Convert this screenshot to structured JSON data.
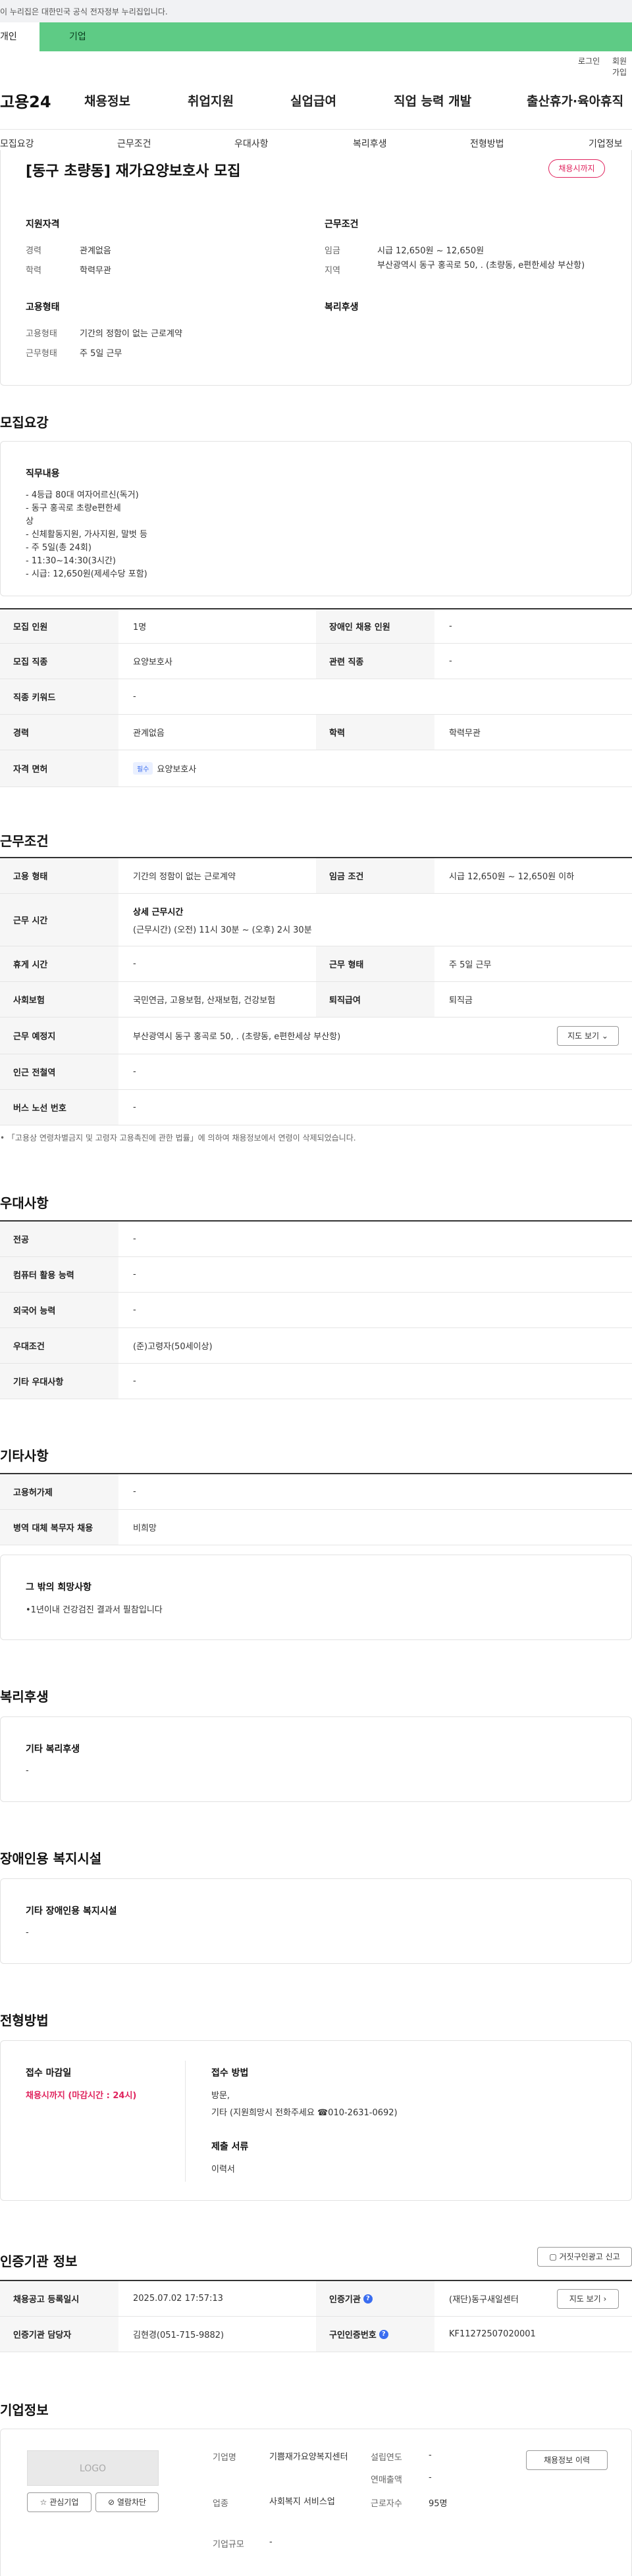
{
  "gov_banner": "이 누리집은 대한민국 공식 전자정부 누리집입니다.",
  "top_tabs": {
    "personal": "개인",
    "company": "기업"
  },
  "util": {
    "login": "로그인",
    "join": "회원가입"
  },
  "logo": "고용24",
  "gnb": [
    "채용정보",
    "취업지원",
    "실업급여",
    "직업 능력 개발",
    "출산휴가·육아휴직"
  ],
  "sub_nav": [
    "모집요강",
    "근무조건",
    "우대사항",
    "복리후생",
    "전형방법",
    "기업정보"
  ],
  "summary": {
    "title": "[동구 초량동] 재가요양보호사 모집",
    "badge": "채용시까지",
    "qual_title": "지원자격",
    "career_label": "경력",
    "career_value": "관계없음",
    "edu_label": "학력",
    "edu_value": "학력무관",
    "cond_title": "근무조건",
    "wage_label": "임금",
    "wage_value": "시급 12,650원 ~ 12,650원",
    "area_label": "지역",
    "area_value": "부산광역시 동구 홍곡로 50, . (초량동, e편한세상 부산항)",
    "emp_title": "고용형태",
    "emp_type_label": "고용형태",
    "emp_type_value": "기간의 정함이 없는 근로계약",
    "work_form_label": "근무형태",
    "work_form_value": "주 5일 근무",
    "welfare_title": "복리후생"
  },
  "recruit": {
    "section_title": "모집요강",
    "duty_title": "직무내용",
    "duty_lines": [
      "- 4등급 80대 여자어르신(독거)",
      "- 동구 홍곡로 초량e편한세",
      "상",
      "- 신체활동지원, 가사지원, 말벗 등",
      "- 주 5일(총 24회)",
      "- 11:30~14:30(3시간)",
      "- 시급: 12,650원(제세수당 포함)"
    ],
    "rows": [
      {
        "l1": "모집 인원",
        "v1": "1명",
        "l2": "장애인 채용 인원",
        "v2": "-"
      },
      {
        "l1": "모집 직종",
        "v1": "요양보호사",
        "l2": "관련 직종",
        "v2": "-"
      },
      {
        "l1": "직종 키워드",
        "v1": "-"
      },
      {
        "l1": "경력",
        "v1": "관계없음",
        "l2": "학력",
        "v2": "학력무관"
      },
      {
        "l1": "자격 면허",
        "tag": "필수",
        "v1": "요양보호사"
      }
    ]
  },
  "work": {
    "section_title": "근무조건",
    "emp_label": "고용 형태",
    "emp_value": "기간의 정함이 없는 근로계약",
    "wage_label": "임금 조건",
    "wage_value": "시급 12,650원 ~ 12,650원 이하",
    "hours_label": "근무 시간",
    "hours_title": "상세 근무시간",
    "hours_value": "(근무시간) (오전) 11시 30분 ~ (오후) 2시 30분",
    "rest_label": "휴게 시간",
    "rest_value": "-",
    "form_label": "근무 형태",
    "form_value": "주 5일 근무",
    "ins_label": "사회보험",
    "ins_value": "국민연금, 고용보험, 산재보험, 건강보험",
    "retire_label": "퇴직급여",
    "retire_value": "퇴직금",
    "place_label": "근무 예정지",
    "place_value": "부산광역시 동구 홍곡로 50, . (초량동, e편한세상 부산항)",
    "map_btn": "지도 보기",
    "subway_label": "인근 전철역",
    "subway_value": "-",
    "bus_label": "버스 노선 번호",
    "bus_value": "-",
    "note": "「고용상 연령차별금지 및 고령자 고용촉진에 관한 법률」에 의하여 채용정보에서 연령이 삭제되었습니다."
  },
  "pref": {
    "section_title": "우대사항",
    "rows": [
      {
        "l": "전공",
        "v": "-"
      },
      {
        "l": "컴퓨터 활용 능력",
        "v": "-"
      },
      {
        "l": "외국어 능력",
        "v": "-"
      },
      {
        "l": "우대조건",
        "v": "(준)고령자(50세이상)"
      },
      {
        "l": "기타 우대사항",
        "v": "-"
      }
    ]
  },
  "etc": {
    "section_title": "기타사항",
    "rows": [
      {
        "l": "고용허가제",
        "v": "-"
      },
      {
        "l": "병역 대체 복무자 채용",
        "v": "비희망"
      }
    ],
    "hope_title": "그 밖의 희망사항",
    "hope_value": "•1년이내 건강검진 결과서 필참입니다"
  },
  "welfare": {
    "section_title": "복리후생",
    "box_title": "기타 복리후생",
    "box_value": "-"
  },
  "disabled": {
    "section_title": "장애인용 복지시설",
    "box_title": "기타 장애인용 복지시설",
    "box_value": "-"
  },
  "selection": {
    "section_title": "전형방법",
    "deadline_title": "접수 마감일",
    "deadline_value": "채용시까지 (마감시간 : 24시)",
    "method_title": "접수 방법",
    "method_line1": "방문,",
    "method_line2": "기타 (지원희망시 전화주세요 ☎010-2631-0692)",
    "docs_title": "제출 서류",
    "docs_value": "이력서"
  },
  "agency": {
    "section_title": "인증기관 정보",
    "report_btn": "거짓구인광고 신고",
    "reg_label": "채용공고 등록일시",
    "reg_value": "2025.07.02 17:57:13",
    "agency_label": "인증기관",
    "agency_value": "(재단)동구새일센터",
    "map_btn": "지도 보기",
    "manager_label": "인증기관 담당자",
    "manager_value": "김현경(051-715-9882)",
    "num_label": "구인인증번호",
    "num_value": "KF11272507020001"
  },
  "company": {
    "section_title": "기업정보",
    "logo_text": "LOGO",
    "fav_btn": "관심기업",
    "block_btn": "열람차단",
    "name_label": "기업명",
    "name_value": "기쁨재가요양복지센터",
    "industry_label": "업종",
    "industry_value": "사회복지 서비스업",
    "size_label": "기업규모",
    "size_value": "-",
    "founded_label": "설립연도",
    "founded_value": "-",
    "sales_label": "연매출액",
    "sales_value": "-",
    "emp_label": "근로자수",
    "emp_value": "95명",
    "history_btn": "채용정보 이력"
  }
}
